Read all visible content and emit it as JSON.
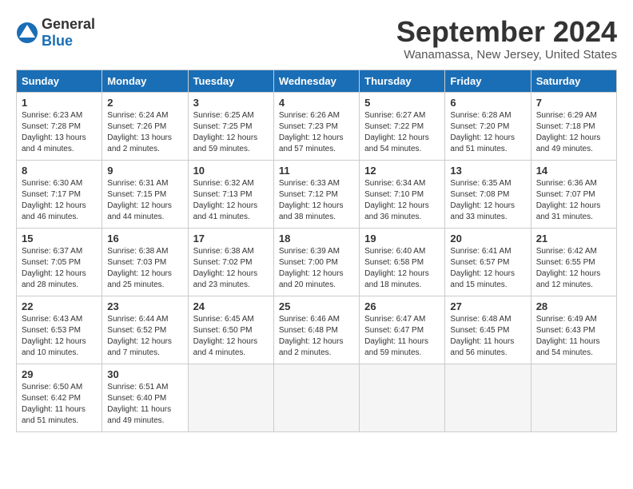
{
  "header": {
    "logo_general": "General",
    "logo_blue": "Blue",
    "month_year": "September 2024",
    "location": "Wanamassa, New Jersey, United States"
  },
  "days_of_week": [
    "Sunday",
    "Monday",
    "Tuesday",
    "Wednesday",
    "Thursday",
    "Friday",
    "Saturday"
  ],
  "weeks": [
    [
      {
        "num": "1",
        "info": "Sunrise: 6:23 AM\nSunset: 7:28 PM\nDaylight: 13 hours\nand 4 minutes."
      },
      {
        "num": "2",
        "info": "Sunrise: 6:24 AM\nSunset: 7:26 PM\nDaylight: 13 hours\nand 2 minutes."
      },
      {
        "num": "3",
        "info": "Sunrise: 6:25 AM\nSunset: 7:25 PM\nDaylight: 12 hours\nand 59 minutes."
      },
      {
        "num": "4",
        "info": "Sunrise: 6:26 AM\nSunset: 7:23 PM\nDaylight: 12 hours\nand 57 minutes."
      },
      {
        "num": "5",
        "info": "Sunrise: 6:27 AM\nSunset: 7:22 PM\nDaylight: 12 hours\nand 54 minutes."
      },
      {
        "num": "6",
        "info": "Sunrise: 6:28 AM\nSunset: 7:20 PM\nDaylight: 12 hours\nand 51 minutes."
      },
      {
        "num": "7",
        "info": "Sunrise: 6:29 AM\nSunset: 7:18 PM\nDaylight: 12 hours\nand 49 minutes."
      }
    ],
    [
      {
        "num": "8",
        "info": "Sunrise: 6:30 AM\nSunset: 7:17 PM\nDaylight: 12 hours\nand 46 minutes."
      },
      {
        "num": "9",
        "info": "Sunrise: 6:31 AM\nSunset: 7:15 PM\nDaylight: 12 hours\nand 44 minutes."
      },
      {
        "num": "10",
        "info": "Sunrise: 6:32 AM\nSunset: 7:13 PM\nDaylight: 12 hours\nand 41 minutes."
      },
      {
        "num": "11",
        "info": "Sunrise: 6:33 AM\nSunset: 7:12 PM\nDaylight: 12 hours\nand 38 minutes."
      },
      {
        "num": "12",
        "info": "Sunrise: 6:34 AM\nSunset: 7:10 PM\nDaylight: 12 hours\nand 36 minutes."
      },
      {
        "num": "13",
        "info": "Sunrise: 6:35 AM\nSunset: 7:08 PM\nDaylight: 12 hours\nand 33 minutes."
      },
      {
        "num": "14",
        "info": "Sunrise: 6:36 AM\nSunset: 7:07 PM\nDaylight: 12 hours\nand 31 minutes."
      }
    ],
    [
      {
        "num": "15",
        "info": "Sunrise: 6:37 AM\nSunset: 7:05 PM\nDaylight: 12 hours\nand 28 minutes."
      },
      {
        "num": "16",
        "info": "Sunrise: 6:38 AM\nSunset: 7:03 PM\nDaylight: 12 hours\nand 25 minutes."
      },
      {
        "num": "17",
        "info": "Sunrise: 6:38 AM\nSunset: 7:02 PM\nDaylight: 12 hours\nand 23 minutes."
      },
      {
        "num": "18",
        "info": "Sunrise: 6:39 AM\nSunset: 7:00 PM\nDaylight: 12 hours\nand 20 minutes."
      },
      {
        "num": "19",
        "info": "Sunrise: 6:40 AM\nSunset: 6:58 PM\nDaylight: 12 hours\nand 18 minutes."
      },
      {
        "num": "20",
        "info": "Sunrise: 6:41 AM\nSunset: 6:57 PM\nDaylight: 12 hours\nand 15 minutes."
      },
      {
        "num": "21",
        "info": "Sunrise: 6:42 AM\nSunset: 6:55 PM\nDaylight: 12 hours\nand 12 minutes."
      }
    ],
    [
      {
        "num": "22",
        "info": "Sunrise: 6:43 AM\nSunset: 6:53 PM\nDaylight: 12 hours\nand 10 minutes."
      },
      {
        "num": "23",
        "info": "Sunrise: 6:44 AM\nSunset: 6:52 PM\nDaylight: 12 hours\nand 7 minutes."
      },
      {
        "num": "24",
        "info": "Sunrise: 6:45 AM\nSunset: 6:50 PM\nDaylight: 12 hours\nand 4 minutes."
      },
      {
        "num": "25",
        "info": "Sunrise: 6:46 AM\nSunset: 6:48 PM\nDaylight: 12 hours\nand 2 minutes."
      },
      {
        "num": "26",
        "info": "Sunrise: 6:47 AM\nSunset: 6:47 PM\nDaylight: 11 hours\nand 59 minutes."
      },
      {
        "num": "27",
        "info": "Sunrise: 6:48 AM\nSunset: 6:45 PM\nDaylight: 11 hours\nand 56 minutes."
      },
      {
        "num": "28",
        "info": "Sunrise: 6:49 AM\nSunset: 6:43 PM\nDaylight: 11 hours\nand 54 minutes."
      }
    ],
    [
      {
        "num": "29",
        "info": "Sunrise: 6:50 AM\nSunset: 6:42 PM\nDaylight: 11 hours\nand 51 minutes."
      },
      {
        "num": "30",
        "info": "Sunrise: 6:51 AM\nSunset: 6:40 PM\nDaylight: 11 hours\nand 49 minutes."
      },
      {
        "num": "",
        "info": ""
      },
      {
        "num": "",
        "info": ""
      },
      {
        "num": "",
        "info": ""
      },
      {
        "num": "",
        "info": ""
      },
      {
        "num": "",
        "info": ""
      }
    ]
  ]
}
